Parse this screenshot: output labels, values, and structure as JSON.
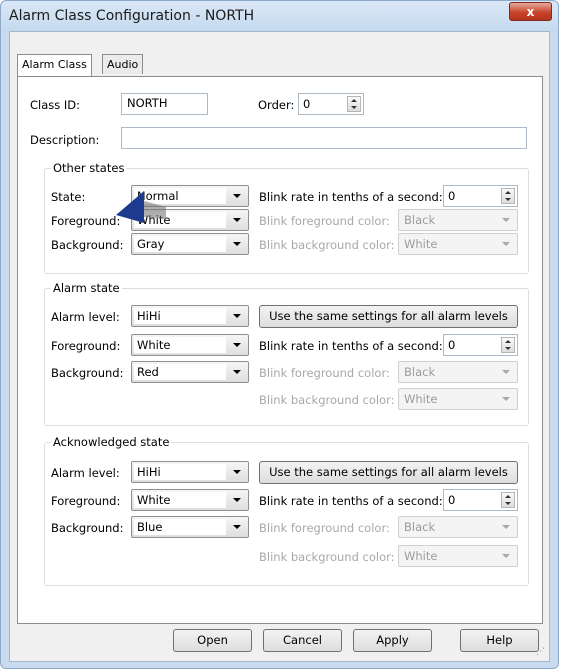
{
  "window": {
    "title": "Alarm Class Configuration - NORTH",
    "close_label": "x"
  },
  "tabs": [
    {
      "label": "Alarm Class"
    },
    {
      "label": "Audio"
    }
  ],
  "header": {
    "class_id_label": "Class ID:",
    "class_id_value": "NORTH",
    "order_label": "Order:",
    "order_value": "0",
    "description_label": "Description:",
    "description_value": ""
  },
  "other_states": {
    "legend": "Other states",
    "state_label": "State:",
    "state_value": "Normal",
    "foreground_label": "Foreground:",
    "foreground_value": "White",
    "background_label": "Background:",
    "background_value": "Gray",
    "blink_rate_label": "Blink rate in tenths of a second:",
    "blink_rate_value": "0",
    "blink_fg_label": "Blink foreground color:",
    "blink_fg_value": "Black",
    "blink_bg_label": "Blink background color:",
    "blink_bg_value": "White"
  },
  "alarm_state": {
    "legend": "Alarm state",
    "level_label": "Alarm level:",
    "level_value": "HiHi",
    "same_settings_label": "Use the same settings for all alarm levels",
    "foreground_label": "Foreground:",
    "foreground_value": "White",
    "background_label": "Background:",
    "background_value": "Red",
    "blink_rate_label": "Blink rate in tenths of a second:",
    "blink_rate_value": "0",
    "blink_fg_label": "Blink foreground color:",
    "blink_fg_value": "Black",
    "blink_bg_label": "Blink background color:",
    "blink_bg_value": "White"
  },
  "ack_state": {
    "legend": "Acknowledged state",
    "level_label": "Alarm level:",
    "level_value": "HiHi",
    "same_settings_label": "Use the same settings for all alarm levels",
    "foreground_label": "Foreground:",
    "foreground_value": "White",
    "background_label": "Background:",
    "background_value": "Blue",
    "blink_rate_label": "Blink rate in tenths of a second:",
    "blink_rate_value": "0",
    "blink_fg_label": "Blink foreground color:",
    "blink_fg_value": "Black",
    "blink_bg_label": "Blink background color:",
    "blink_bg_value": "White"
  },
  "footer": {
    "open_label": "Open",
    "cancel_label": "Cancel",
    "apply_label": "Apply",
    "help_label": "Help"
  },
  "colors": {
    "pointer": "#1d3a8f",
    "close_button": "#c8452c"
  }
}
